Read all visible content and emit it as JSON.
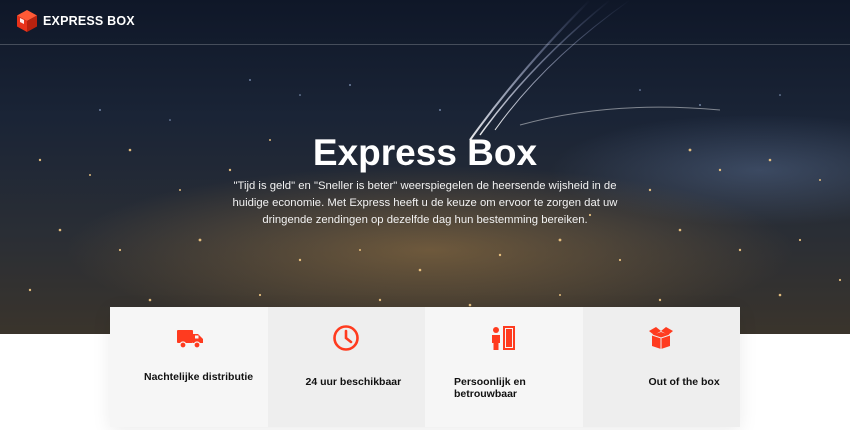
{
  "header": {
    "brand_name": "EXPRESS BOX",
    "logo_icon": "cube-box-logo-icon"
  },
  "hero": {
    "title": "Express Box",
    "text": "\"Tijd is geld\" en \"Sneller is beter\" weerspiegelen de heersende wijsheid in de huidige economie. Met Express heeft u de keuze om ervoor te zorgen dat uw dringende zendingen op dezelfde dag hun bestemming bereiken."
  },
  "features": [
    {
      "label": "Nachtelijke distributie",
      "icon": "truck-icon"
    },
    {
      "label": "24 uur beschikbaar",
      "icon": "clock-icon"
    },
    {
      "label": "Persoonlijk en betrouwbaar",
      "icon": "person-door-icon"
    },
    {
      "label": "Out of the box",
      "icon": "open-box-icon"
    }
  ],
  "colors": {
    "accent": "#ff3b1f",
    "hero_text": "#ffffff",
    "feature_label": "#111111"
  }
}
